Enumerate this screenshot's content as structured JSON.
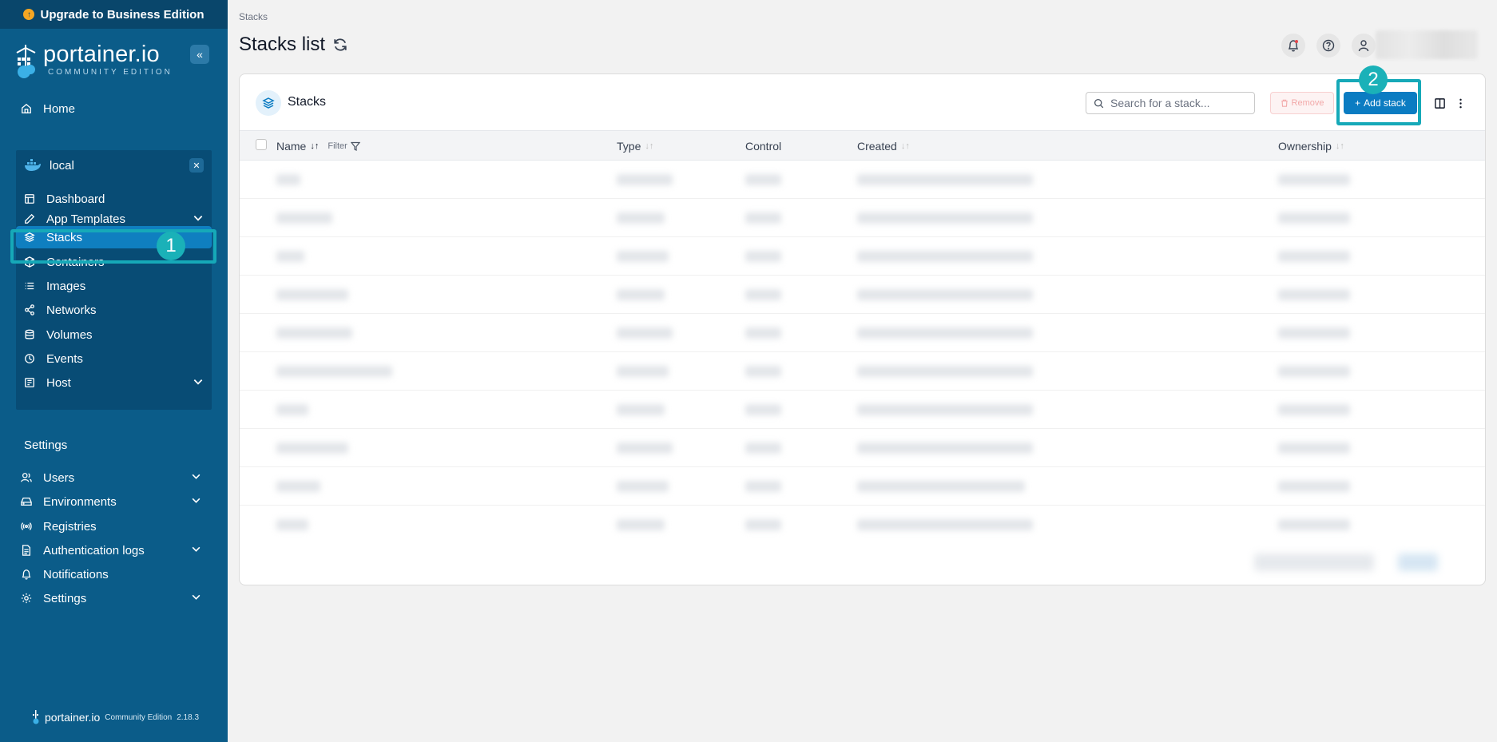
{
  "sidebar": {
    "upgrade_label": "Upgrade to Business Edition",
    "brand_name": "portainer.io",
    "brand_sub": "COMMUNITY EDITION",
    "home_label": "Home",
    "environment": {
      "name": "local",
      "items": [
        {
          "label": "Dashboard"
        },
        {
          "label": "App Templates"
        },
        {
          "label": "Stacks"
        },
        {
          "label": "Containers"
        },
        {
          "label": "Images"
        },
        {
          "label": "Networks"
        },
        {
          "label": "Volumes"
        },
        {
          "label": "Events"
        },
        {
          "label": "Host"
        }
      ]
    },
    "settings_heading": "Settings",
    "settings_items": [
      {
        "label": "Users"
      },
      {
        "label": "Environments"
      },
      {
        "label": "Registries"
      },
      {
        "label": "Authentication logs"
      },
      {
        "label": "Notifications"
      },
      {
        "label": "Settings"
      }
    ],
    "footer": {
      "name": "portainer.io",
      "edition": "Community Edition",
      "version": "2.18.3"
    }
  },
  "annotations": {
    "step1": "1",
    "step2": "2"
  },
  "header": {
    "breadcrumb": "Stacks",
    "title": "Stacks list"
  },
  "card": {
    "title": "Stacks",
    "search_placeholder": "Search for a stack...",
    "remove_label": "Remove",
    "add_label": "Add stack",
    "columns": {
      "name": "Name",
      "filter": "Filter",
      "type": "Type",
      "control": "Control",
      "created": "Created",
      "ownership": "Ownership"
    }
  },
  "colors": {
    "sidebar": "#0b5c89",
    "accent": "#0b7cc2",
    "annotation": "#16a9b8"
  }
}
